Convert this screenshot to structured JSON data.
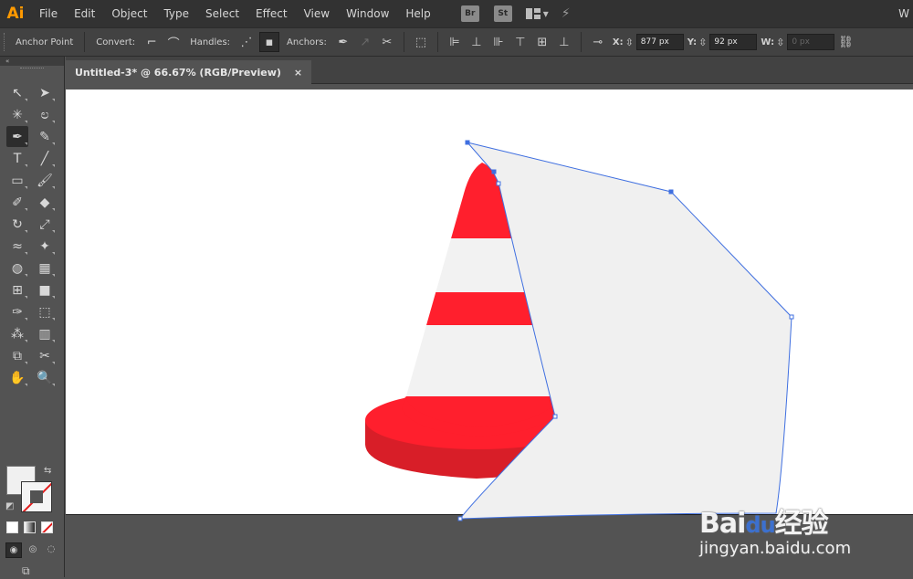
{
  "menubar": {
    "app_logo": "Ai",
    "items": [
      "File",
      "Edit",
      "Object",
      "Type",
      "Select",
      "Effect",
      "View",
      "Window",
      "Help"
    ],
    "bridge_label": "Br",
    "stock_label": "St",
    "right_text": "W"
  },
  "control": {
    "mode_label": "Anchor Point",
    "convert_label": "Convert:",
    "handles_label": "Handles:",
    "anchors_label": "Anchors:",
    "x_label": "X:",
    "x_value": "877 px",
    "y_label": "Y:",
    "y_value": "92 px",
    "w_label": "W:",
    "w_value": "0 px"
  },
  "toolbox": {
    "header": "«",
    "tools": [
      {
        "name": "selection-tool-icon",
        "glyph": "↖",
        "active": false
      },
      {
        "name": "direct-selection-tool-icon",
        "glyph": "➤",
        "active": false
      },
      {
        "name": "magic-wand-tool-icon",
        "glyph": "✳",
        "active": false
      },
      {
        "name": "lasso-tool-icon",
        "glyph": "ಲ",
        "active": false
      },
      {
        "name": "pen-tool-icon",
        "glyph": "✒",
        "active": true
      },
      {
        "name": "curvature-tool-icon",
        "glyph": "✎",
        "active": false
      },
      {
        "name": "type-tool-icon",
        "glyph": "T",
        "active": false
      },
      {
        "name": "line-tool-icon",
        "glyph": "╱",
        "active": false
      },
      {
        "name": "rectangle-tool-icon",
        "glyph": "▭",
        "active": false
      },
      {
        "name": "paintbrush-tool-icon",
        "glyph": "🖌",
        "active": false
      },
      {
        "name": "shaper-tool-icon",
        "glyph": "✐",
        "active": false
      },
      {
        "name": "eraser-tool-icon",
        "glyph": "◆",
        "active": false
      },
      {
        "name": "rotate-tool-icon",
        "glyph": "↻",
        "active": false
      },
      {
        "name": "scale-tool-icon",
        "glyph": "⤢",
        "active": false
      },
      {
        "name": "width-tool-icon",
        "glyph": "≈",
        "active": false
      },
      {
        "name": "puppet-warp-tool-icon",
        "glyph": "✦",
        "active": false
      },
      {
        "name": "shape-builder-tool-icon",
        "glyph": "◍",
        "active": false
      },
      {
        "name": "perspective-grid-tool-icon",
        "glyph": "▦",
        "active": false
      },
      {
        "name": "mesh-tool-icon",
        "glyph": "⊞",
        "active": false
      },
      {
        "name": "gradient-tool-icon",
        "glyph": "■",
        "active": false
      },
      {
        "name": "eyedropper-tool-icon",
        "glyph": "✑",
        "active": false
      },
      {
        "name": "blend-tool-icon",
        "glyph": "⬚",
        "active": false
      },
      {
        "name": "symbol-sprayer-tool-icon",
        "glyph": "⁂",
        "active": false
      },
      {
        "name": "column-graph-tool-icon",
        "glyph": "▥",
        "active": false
      },
      {
        "name": "artboard-tool-icon",
        "glyph": "⧉",
        "active": false
      },
      {
        "name": "slice-tool-icon",
        "glyph": "✂",
        "active": false
      },
      {
        "name": "hand-tool-icon",
        "glyph": "✋",
        "active": false
      },
      {
        "name": "zoom-tool-icon",
        "glyph": "🔍",
        "active": false
      }
    ]
  },
  "document": {
    "tab_title": "Untitled-3* @ 66.67% (RGB/Preview)",
    "tab_close": "×"
  },
  "colors": {
    "cone_red": "#ff1f2d",
    "cone_red_dark": "#d81e28",
    "cone_white": "#f2f2f2",
    "shape_fill": "#f0f0f0",
    "path_blue": "#3f6fe0",
    "fill_swatch": "#f0f0f0"
  },
  "watermark": {
    "brand": "Bai",
    "brand_paw": "du",
    "brand_cn": "经验",
    "url": "jingyan.baidu.com"
  }
}
